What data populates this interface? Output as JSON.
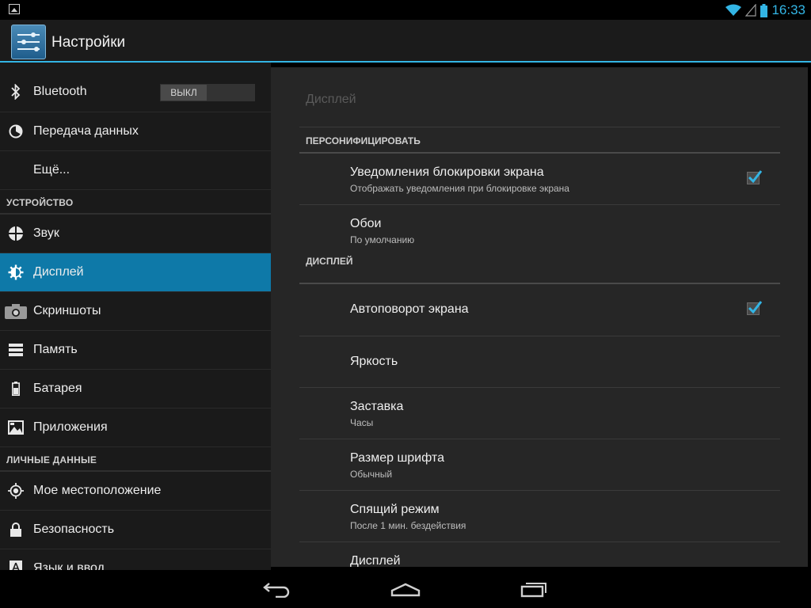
{
  "status_bar": {
    "time": "16:33",
    "icons": [
      "gallery-notification-icon",
      "wifi-icon",
      "signal-icon",
      "battery-icon"
    ]
  },
  "action_bar": {
    "title": "Настройки",
    "icon": "settings-sliders-icon"
  },
  "sidebar": {
    "items_top": [
      {
        "label": "Bluetooth",
        "icon": "bluetooth-icon",
        "toggle": "ВЫКЛ"
      },
      {
        "label": "Передача данных",
        "icon": "data-usage-icon"
      },
      {
        "label": "Ещё..."
      }
    ],
    "section_device": "УСТРОЙСТВО",
    "items_device": [
      {
        "label": "Звук",
        "icon": "sound-icon"
      },
      {
        "label": "Дисплей",
        "icon": "display-icon",
        "selected": true
      },
      {
        "label": "Скриншоты",
        "icon": "camera-icon"
      },
      {
        "label": "Память",
        "icon": "storage-icon"
      },
      {
        "label": "Батарея",
        "icon": "battery-icon"
      },
      {
        "label": "Приложения",
        "icon": "apps-icon"
      }
    ],
    "section_personal": "ЛИЧНЫЕ ДАННЫЕ",
    "items_personal": [
      {
        "label": "Мое местоположение",
        "icon": "location-icon"
      },
      {
        "label": "Безопасность",
        "icon": "lock-icon"
      },
      {
        "label": "Язык и ввод",
        "icon": "language-icon"
      }
    ]
  },
  "detail": {
    "title": "Дисплей",
    "section_personalize": "ПЕРСОНИФИЦИРОВАТЬ",
    "lockscreen_notifications": {
      "title": "Уведомления блокировки экрана",
      "summary": "Отображать уведомления при блокировке экрана",
      "checked": true
    },
    "wallpaper": {
      "title": "Обои",
      "summary": "По умолчанию"
    },
    "section_display": "ДИСПЛЕЙ",
    "auto_rotate": {
      "title": "Автоповорот экрана",
      "checked": true
    },
    "brightness": {
      "title": "Яркость"
    },
    "daydream": {
      "title": "Заставка",
      "summary": "Часы"
    },
    "font_size": {
      "title": "Размер шрифта",
      "summary": "Обычный"
    },
    "sleep": {
      "title": "Спящий режим",
      "summary": "После 1 мин. бездействия"
    },
    "display_item": {
      "title": "Дисплей"
    }
  },
  "nav_bar": {
    "buttons": [
      "back-icon",
      "home-icon",
      "recents-icon"
    ]
  },
  "colors": {
    "accent": "#33b5e5",
    "selected": "#0e79a8",
    "check": "#33b5e5"
  }
}
